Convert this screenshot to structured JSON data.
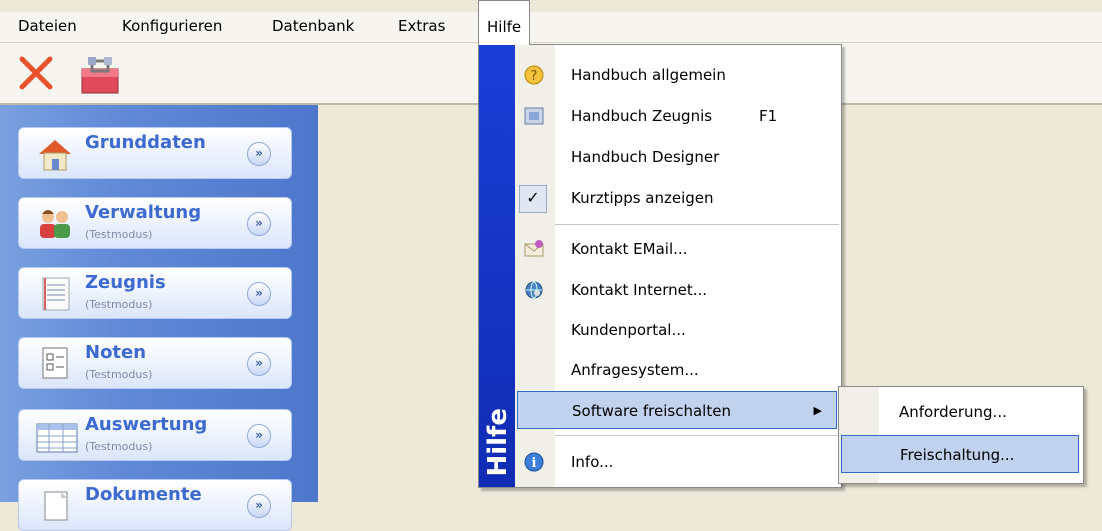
{
  "menubar": {
    "items": [
      {
        "label": "Dateien"
      },
      {
        "label": "Konfigurieren"
      },
      {
        "label": "Datenbank"
      },
      {
        "label": "Extras"
      },
      {
        "label": "Hilfe"
      }
    ]
  },
  "toolbar": {
    "buttons": [
      {
        "icon": "close-x-icon"
      },
      {
        "icon": "toolbox-icon"
      }
    ]
  },
  "sidebar": {
    "panels": [
      {
        "title": "Grunddaten",
        "subtitle": "",
        "icon": "house-icon"
      },
      {
        "title": "Verwaltung",
        "subtitle": "(Testmodus)",
        "icon": "people-icon"
      },
      {
        "title": "Zeugnis",
        "subtitle": "(Testmodus)",
        "icon": "document-icon"
      },
      {
        "title": "Noten",
        "subtitle": "(Testmodus)",
        "icon": "grade-sheet-icon"
      },
      {
        "title": "Auswertung",
        "subtitle": "(Testmodus)",
        "icon": "table-icon"
      },
      {
        "title": "Dokumente",
        "subtitle": "",
        "icon": "documents-icon"
      }
    ]
  },
  "help_menu": {
    "strip_label": "Hilfe",
    "items": [
      {
        "label": "Handbuch allgemein",
        "icon": "help-book-icon"
      },
      {
        "label": "Handbuch Zeugnis",
        "shortcut": "F1",
        "icon": "manual-icon"
      },
      {
        "label": "Handbuch Designer"
      },
      {
        "label": "Kurztipps anzeigen",
        "checked": true
      },
      {
        "label": "Kontakt EMail...",
        "icon": "email-icon"
      },
      {
        "label": "Kontakt Internet...",
        "icon": "internet-icon"
      },
      {
        "label": "Kundenportal..."
      },
      {
        "label": "Anfragesystem..."
      },
      {
        "label": "Software freischalten",
        "has_submenu": true
      },
      {
        "label": "Info...",
        "icon": "info-icon"
      }
    ]
  },
  "submenu": {
    "items": [
      {
        "label": "Anforderung..."
      },
      {
        "label": "Freischaltung..."
      }
    ]
  },
  "colors": {
    "sidebar_blue": "#5f88d6",
    "menu_strip": "#1a3fd6",
    "highlight": "#c1d2ee"
  }
}
